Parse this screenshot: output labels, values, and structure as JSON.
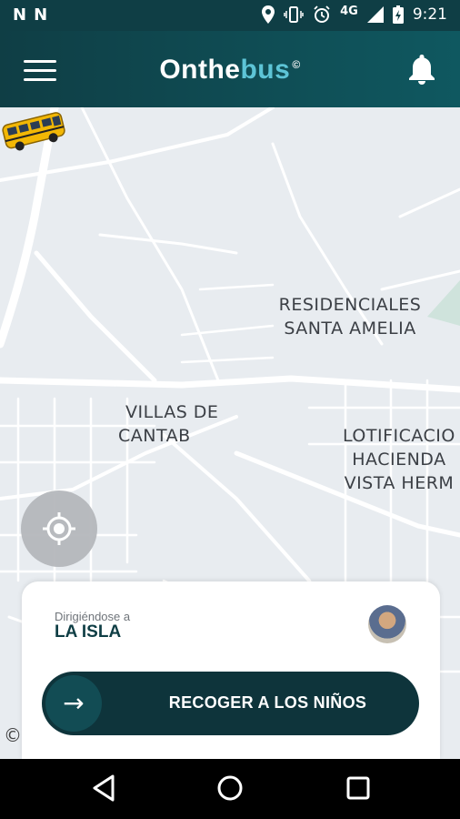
{
  "status_bar": {
    "left_icons": [
      "N",
      "N"
    ],
    "network": "4G",
    "time": "9:21"
  },
  "app_bar": {
    "brand_part1": "Onthe",
    "brand_part2": "bus",
    "brand_mark": "©"
  },
  "map": {
    "places": [
      {
        "line1": "RESIDENCIALES",
        "line2": "SANTA AMELIA"
      },
      {
        "line1": "VILLAS DE",
        "line2": "CANTAB"
      },
      {
        "line1": "LOTIFICACIO",
        "line2": "HACIENDA",
        "line3": "VISTA HERM"
      }
    ],
    "copyright_mark": "©"
  },
  "trip_card": {
    "heading_label": "Dirigiéndose a",
    "destination": "LA ISLA",
    "action_label": "RECOGER A LOS NIÑOS",
    "action_icon": "→"
  },
  "colors": {
    "brand_dark": "#0f3e45",
    "brand_accent": "#5dc4d6",
    "button_bg": "#0e343b"
  }
}
